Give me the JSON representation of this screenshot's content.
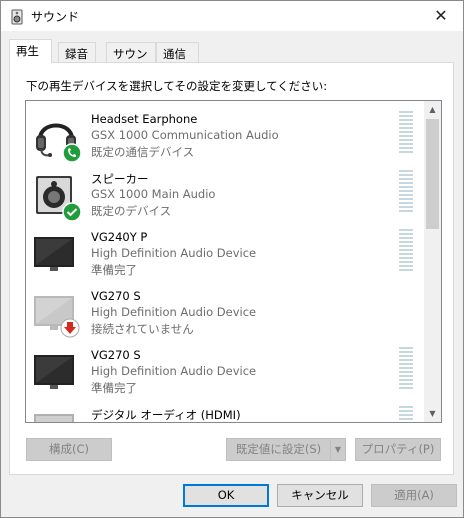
{
  "window": {
    "title": "サウンド"
  },
  "tabs": [
    {
      "label": "再生",
      "active": true
    },
    {
      "label": "録音",
      "active": false
    },
    {
      "label": "サウンド",
      "active": false
    },
    {
      "label": "通信",
      "active": false
    }
  ],
  "playback": {
    "instruction": "下の再生デバイスを選択してその設定を変更してください:",
    "devices": [
      {
        "name": "Headset Earphone",
        "description": "GSX 1000 Communication Audio",
        "status": "既定の通信デバイス",
        "icon": "headset-icon",
        "badge": "phone-check-badge"
      },
      {
        "name": "スピーカー",
        "description": "GSX 1000 Main Audio",
        "status": "既定のデバイス",
        "icon": "speaker-icon",
        "badge": "check-badge"
      },
      {
        "name": "VG240Y P",
        "description": "High Definition Audio Device",
        "status": "準備完了",
        "icon": "monitor-icon",
        "badge": ""
      },
      {
        "name": "VG270 S",
        "description": "High Definition Audio Device",
        "status": "接続されていません",
        "icon": "monitor-disconnected-icon",
        "badge": "down-arrow-badge"
      },
      {
        "name": "VG270 S",
        "description": "High Definition Audio Device",
        "status": "準備完了",
        "icon": "monitor-icon",
        "badge": ""
      },
      {
        "name": "デジタル オーディオ (HDMI)",
        "description": "",
        "status": "",
        "icon": "monitor-icon",
        "badge": ""
      }
    ],
    "buttons": {
      "configure": "構成(C)",
      "set_default": "既定値に設定(S)",
      "properties": "プロパティ(P)"
    }
  },
  "footer": {
    "ok": "OK",
    "cancel": "キャンセル",
    "apply": "適用(A)"
  },
  "colors": {
    "accent": "#0078d7",
    "badge_green": "#1f9d3a",
    "badge_red": "#d42a20",
    "meter": "#c7d7e0"
  }
}
